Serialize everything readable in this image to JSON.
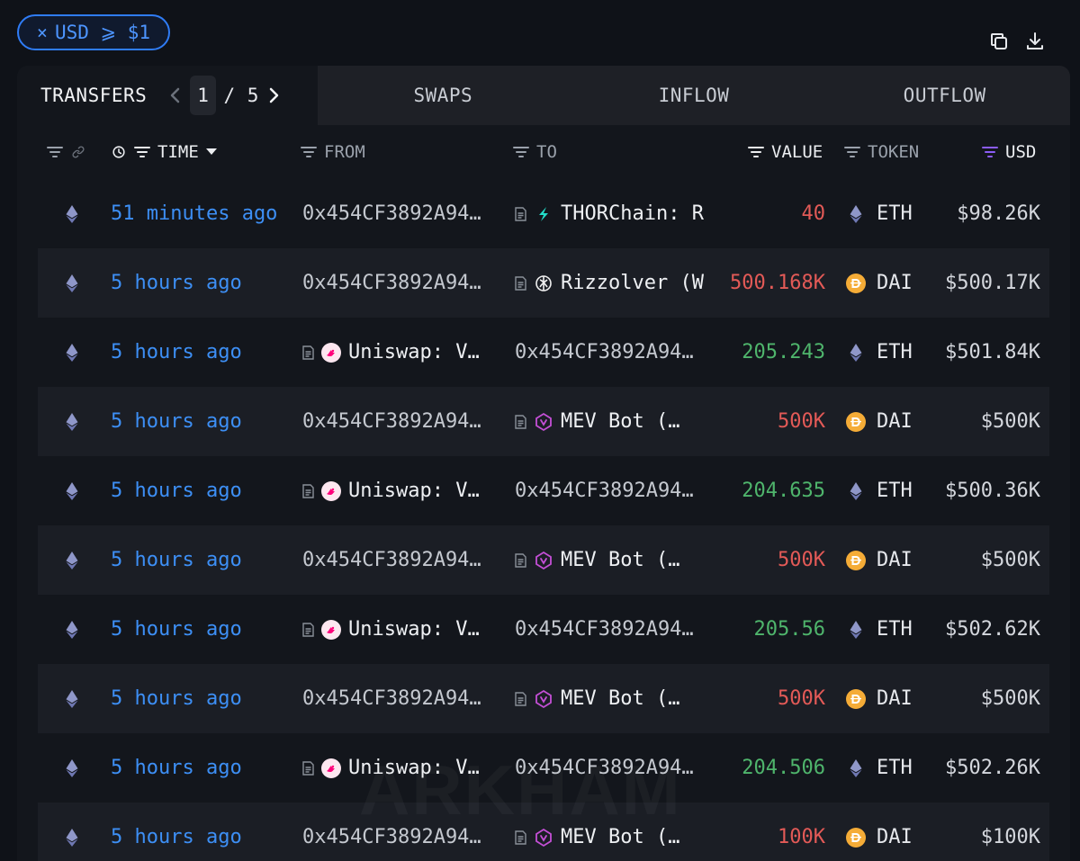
{
  "filter_chip": {
    "close": "×",
    "label": "USD ⩾ $1"
  },
  "top_actions": {
    "copy_icon": "copy-icon",
    "download_icon": "download-icon"
  },
  "tabs": {
    "transfers": "TRANSFERS",
    "page_current": "1",
    "page_total": "/ 5",
    "swaps": "SWAPS",
    "inflow": "INFLOW",
    "outflow": "OUTFLOW"
  },
  "columns": {
    "time": "TIME",
    "from": "FROM",
    "to": "TO",
    "value": "VALUE",
    "token": "TOKEN",
    "usd": "USD"
  },
  "colors": {
    "accent": "#2f7cf6",
    "time_link": "#3d8ff5",
    "outflow_value": "#e35a57",
    "inflow_value": "#4fb56c",
    "usd_filter_active": "#8b5cf6"
  },
  "rows": [
    {
      "chain": "eth-icon",
      "time": "51 minutes ago",
      "from": "0x454CF3892A94…",
      "from_entity": false,
      "to": "THORChain: R",
      "to_entity": true,
      "to_logo": "thorchain-icon",
      "value": "40",
      "direction": "out",
      "token": "ETH",
      "token_icon": "eth-icon",
      "usd": "$98.26K"
    },
    {
      "chain": "eth-icon",
      "time": "5 hours ago",
      "from": "0x454CF3892A94…",
      "from_entity": false,
      "to": "Rizzolver (W",
      "to_entity": true,
      "to_logo": "rizzolver-icon",
      "value": "500.168K",
      "direction": "out",
      "token": "DAI",
      "token_icon": "dai-icon",
      "usd": "$500.17K"
    },
    {
      "chain": "eth-icon",
      "time": "5 hours ago",
      "from": "Uniswap: V…",
      "from_entity": true,
      "from_logo": "uniswap-icon",
      "to": "0x454CF3892A94…",
      "to_entity": false,
      "value": "205.243",
      "direction": "in",
      "token": "ETH",
      "token_icon": "eth-icon",
      "usd": "$501.84K"
    },
    {
      "chain": "eth-icon",
      "time": "5 hours ago",
      "from": "0x454CF3892A94…",
      "from_entity": false,
      "to": "MEV Bot (…",
      "to_entity": true,
      "to_logo": "mev-bot-icon",
      "value": "500K",
      "direction": "out",
      "token": "DAI",
      "token_icon": "dai-icon",
      "usd": "$500K"
    },
    {
      "chain": "eth-icon",
      "time": "5 hours ago",
      "from": "Uniswap: V…",
      "from_entity": true,
      "from_logo": "uniswap-icon",
      "to": "0x454CF3892A94…",
      "to_entity": false,
      "value": "204.635",
      "direction": "in",
      "token": "ETH",
      "token_icon": "eth-icon",
      "usd": "$500.36K"
    },
    {
      "chain": "eth-icon",
      "time": "5 hours ago",
      "from": "0x454CF3892A94…",
      "from_entity": false,
      "to": "MEV Bot (…",
      "to_entity": true,
      "to_logo": "mev-bot-icon",
      "value": "500K",
      "direction": "out",
      "token": "DAI",
      "token_icon": "dai-icon",
      "usd": "$500K"
    },
    {
      "chain": "eth-icon",
      "time": "5 hours ago",
      "from": "Uniswap: V…",
      "from_entity": true,
      "from_logo": "uniswap-icon",
      "to": "0x454CF3892A94…",
      "to_entity": false,
      "value": "205.56",
      "direction": "in",
      "token": "ETH",
      "token_icon": "eth-icon",
      "usd": "$502.62K"
    },
    {
      "chain": "eth-icon",
      "time": "5 hours ago",
      "from": "0x454CF3892A94…",
      "from_entity": false,
      "to": "MEV Bot (…",
      "to_entity": true,
      "to_logo": "mev-bot-icon",
      "value": "500K",
      "direction": "out",
      "token": "DAI",
      "token_icon": "dai-icon",
      "usd": "$500K"
    },
    {
      "chain": "eth-icon",
      "time": "5 hours ago",
      "from": "Uniswap: V…",
      "from_entity": true,
      "from_logo": "uniswap-icon",
      "to": "0x454CF3892A94…",
      "to_entity": false,
      "value": "204.506",
      "direction": "in",
      "token": "ETH",
      "token_icon": "eth-icon",
      "usd": "$502.26K"
    },
    {
      "chain": "eth-icon",
      "time": "5 hours ago",
      "from": "0x454CF3892A94…",
      "from_entity": false,
      "to": "MEV Bot (…",
      "to_entity": true,
      "to_logo": "mev-bot-icon",
      "value": "100K",
      "direction": "out",
      "token": "DAI",
      "token_icon": "dai-icon",
      "usd": "$100K"
    }
  ],
  "watermark": "ARKHAM"
}
